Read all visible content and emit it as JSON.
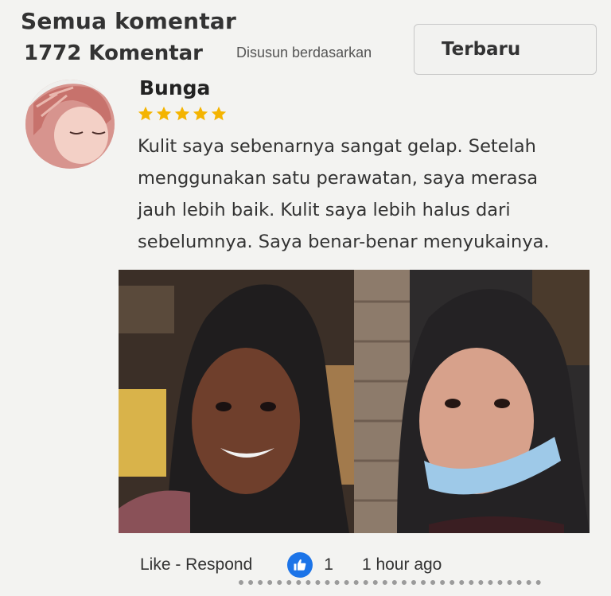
{
  "header": {
    "title": "Semua komentar",
    "count_label": "1772 Komentar",
    "sort_label": "Disusun berdasarkan",
    "sort_value": "Terbaru"
  },
  "comment": {
    "username": "Bunga",
    "rating": 5,
    "text_lines": [
      "Kulit saya sebenarnya sangat gelap. Setelah",
      "menggunakan satu perawatan, saya merasa",
      "jauh lebih baik. Kulit saya lebih halus dari",
      "sebelumnya. Saya benar-benar menyukainya."
    ],
    "footer": {
      "like_respond": "Like - Respond",
      "like_count": "1",
      "time": "1 hour ago"
    }
  },
  "colors": {
    "star": "#f4b400",
    "like": "#1c74e8",
    "background": "#f3f3f1"
  },
  "icons": {
    "rating": "star-icon",
    "like": "thumbs-up-icon"
  }
}
